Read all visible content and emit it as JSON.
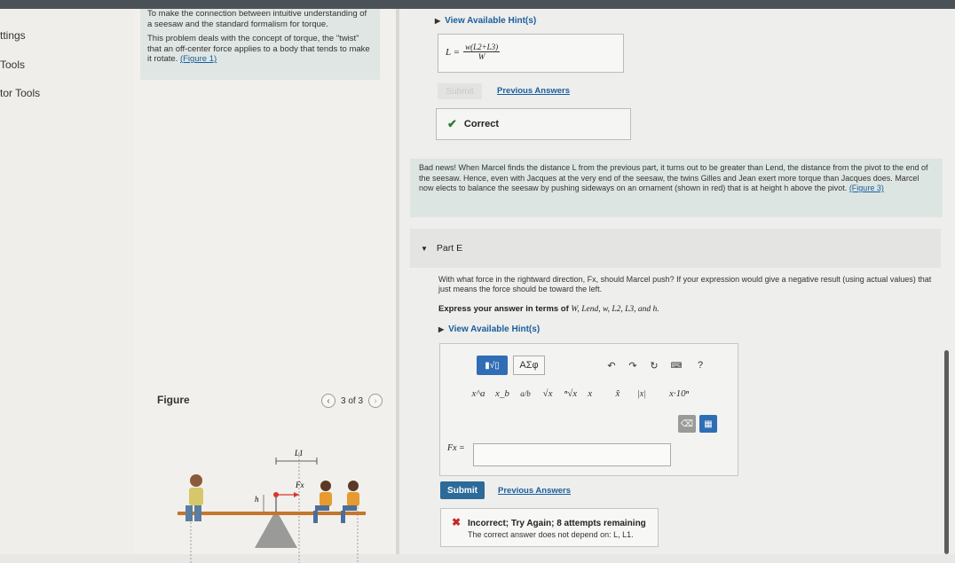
{
  "sidebar": {
    "items": [
      {
        "label": "ttings"
      },
      {
        "label": "Tools"
      },
      {
        "label": "tor Tools"
      }
    ]
  },
  "intro": {
    "p1": "To make the connection between intuitive understanding of a seesaw and the standard formalism for torque.",
    "p2": "This problem deals with the concept of torque, the \"twist\" that an off-center force applies to a body that tends to make it rotate.",
    "figure_link": "(Figure 1)"
  },
  "figure": {
    "label": "Figure",
    "pager": "3 of 3",
    "labels": {
      "L1": "L1",
      "Fx": "Fx",
      "h": "h"
    }
  },
  "previous_part": {
    "hint_label": "View Available Hint(s)",
    "answer_lhs": "L =",
    "answer_num": "w(L2+L3)",
    "answer_den": "W",
    "submit_label": "Submit",
    "previous_answers_label": "Previous Answers",
    "status": "Correct"
  },
  "news": {
    "text": "Bad news! When Marcel finds the distance L from the previous part, it turns out to be greater than Lend, the distance from the pivot to the end of the seesaw. Hence, even with Jacques at the very end of the seesaw, the twins Gilles and Jean exert more torque than Jacques does. Marcel now elects to balance the seesaw by pushing sideways on an ornament (shown in red) that is at height h above the pivot.",
    "figure_link": "(Figure 3)"
  },
  "part": {
    "label": "Part E",
    "question": "With what force in the rightward direction, Fx, should Marcel push? If your expression would give a negative result (using actual values) that just means the force should be toward the left.",
    "express_prefix": "Express your answer in terms of",
    "express_vars": "W, Lend, w, L2, L3, and h.",
    "hint_label": "View Available Hint(s)"
  },
  "editor": {
    "greek_label": "ΑΣφ",
    "symbols": [
      "x^a",
      "x_b",
      "a/b",
      "√x",
      "ⁿ√x",
      "x⃗",
      "x̂",
      "|x|",
      "x·10ⁿ"
    ],
    "help": "?",
    "input_label": "Fx =",
    "input_value": ""
  },
  "part_actions": {
    "submit_label": "Submit",
    "previous_answers_label": "Previous Answers"
  },
  "feedback": {
    "title": "Incorrect; Try Again; 8 attempts remaining",
    "detail": "The correct answer does not depend on: L, L1."
  },
  "colors": {
    "accent": "#2f6db5",
    "link": "#1a5e9c",
    "correct": "#2e7d32",
    "incorrect": "#c62828"
  }
}
